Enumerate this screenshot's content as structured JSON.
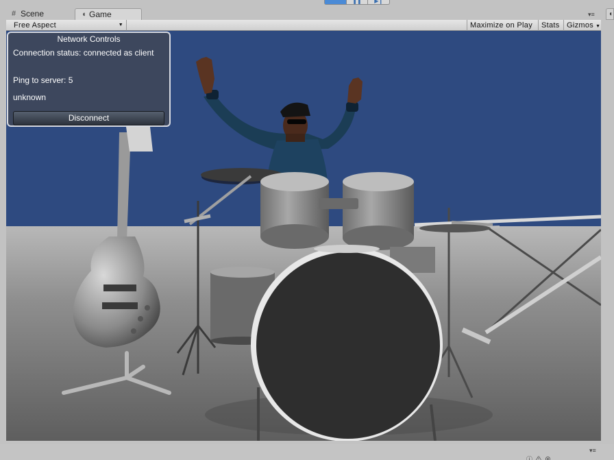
{
  "tabs": [
    {
      "label": "Scene",
      "icon": "grid-icon"
    },
    {
      "label": "Game",
      "icon": "pacman-icon"
    }
  ],
  "toolbar": {
    "aspect": "Free Aspect",
    "maximize": "Maximize on Play",
    "stats": "Stats",
    "gizmos": "Gizmos"
  },
  "network": {
    "title": "Network Controls",
    "status": "Connection status: connected as client",
    "ping": "Ping to server: 5",
    "info": "unknown",
    "disconnect": "Disconnect"
  },
  "colors": {
    "sky": "#2e4a80",
    "floor": "#8a8a8a",
    "panel": "#3e475a",
    "play_active": "#4a8ad6"
  }
}
